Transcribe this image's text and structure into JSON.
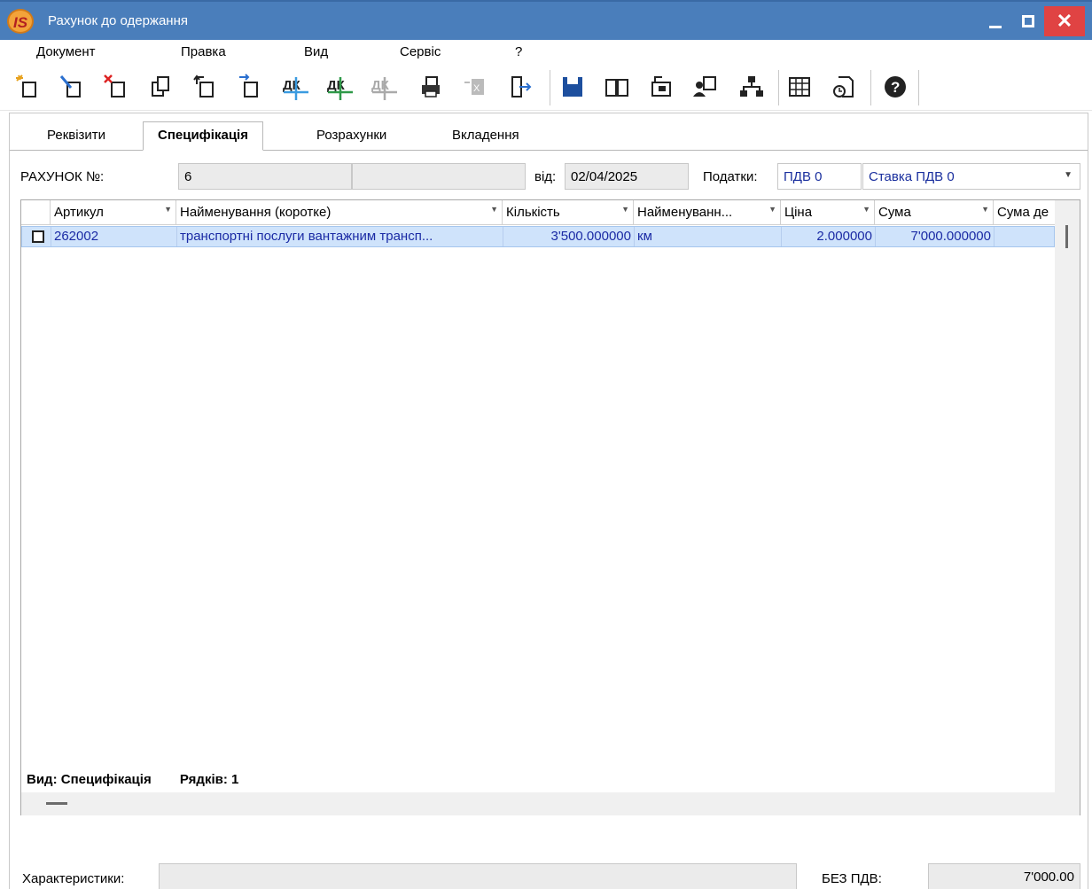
{
  "window": {
    "title": "Рахунок до одержання",
    "logo_text": "IS"
  },
  "menu": [
    "Документ",
    "Правка",
    "Вид",
    "Сервіс",
    "?"
  ],
  "toolbar_icons": [
    "new-document-icon",
    "edit-document-icon",
    "delete-document-icon",
    "copy-document-icon",
    "document-arrow-up-icon",
    "document-arrow-right-icon",
    "debit-credit-blue-icon",
    "debit-credit-green-icon",
    "debit-credit-gray-icon",
    "print-icon",
    "disabled-export-icon",
    "exit-icon",
    "save-icon",
    "book-icon",
    "archive-icon",
    "user-document-icon",
    "hierarchy-icon",
    "table-icon",
    "document-clock-icon",
    "help-icon"
  ],
  "tabs": [
    "Реквізити",
    "Специфікація",
    "Розрахунки",
    "Вкладення"
  ],
  "active_tab": "Специфікація",
  "invoice": {
    "number_label": "РАХУНОК №:",
    "number": "6",
    "number_extra": "",
    "date_label": "від:",
    "date": "02/04/2025",
    "taxes_label": "Податки:",
    "tax_code": "ПДВ  0",
    "tax_rate": "Ставка ПДВ 0"
  },
  "grid": {
    "columns": [
      "Артикул",
      "Найменування (коротке)",
      "Кількість",
      "Найменуванн...",
      "Ціна",
      "Сума",
      "Сума де"
    ],
    "rows": [
      {
        "checked": false,
        "article": "262002",
        "name": "транспортні послуги вантажним трансп...",
        "quantity": "3'500.000000",
        "unit": "км",
        "price": "2.000000",
        "sum": "7'000.000000",
        "sum_extra": ""
      }
    ],
    "status_view": "Вид: Специфікація",
    "status_rows": "Рядків: 1"
  },
  "footer": {
    "characteristics_label": "Характеристики:",
    "characteristics_value": "",
    "without_vat_label": "БЕЗ ПДВ:",
    "without_vat_value": "7'000.00"
  },
  "colors": {
    "titlebar": "#4a7ebb",
    "close": "#e04343",
    "selected_row": "#cfe3fb",
    "data_text": "#1b2ba5"
  }
}
